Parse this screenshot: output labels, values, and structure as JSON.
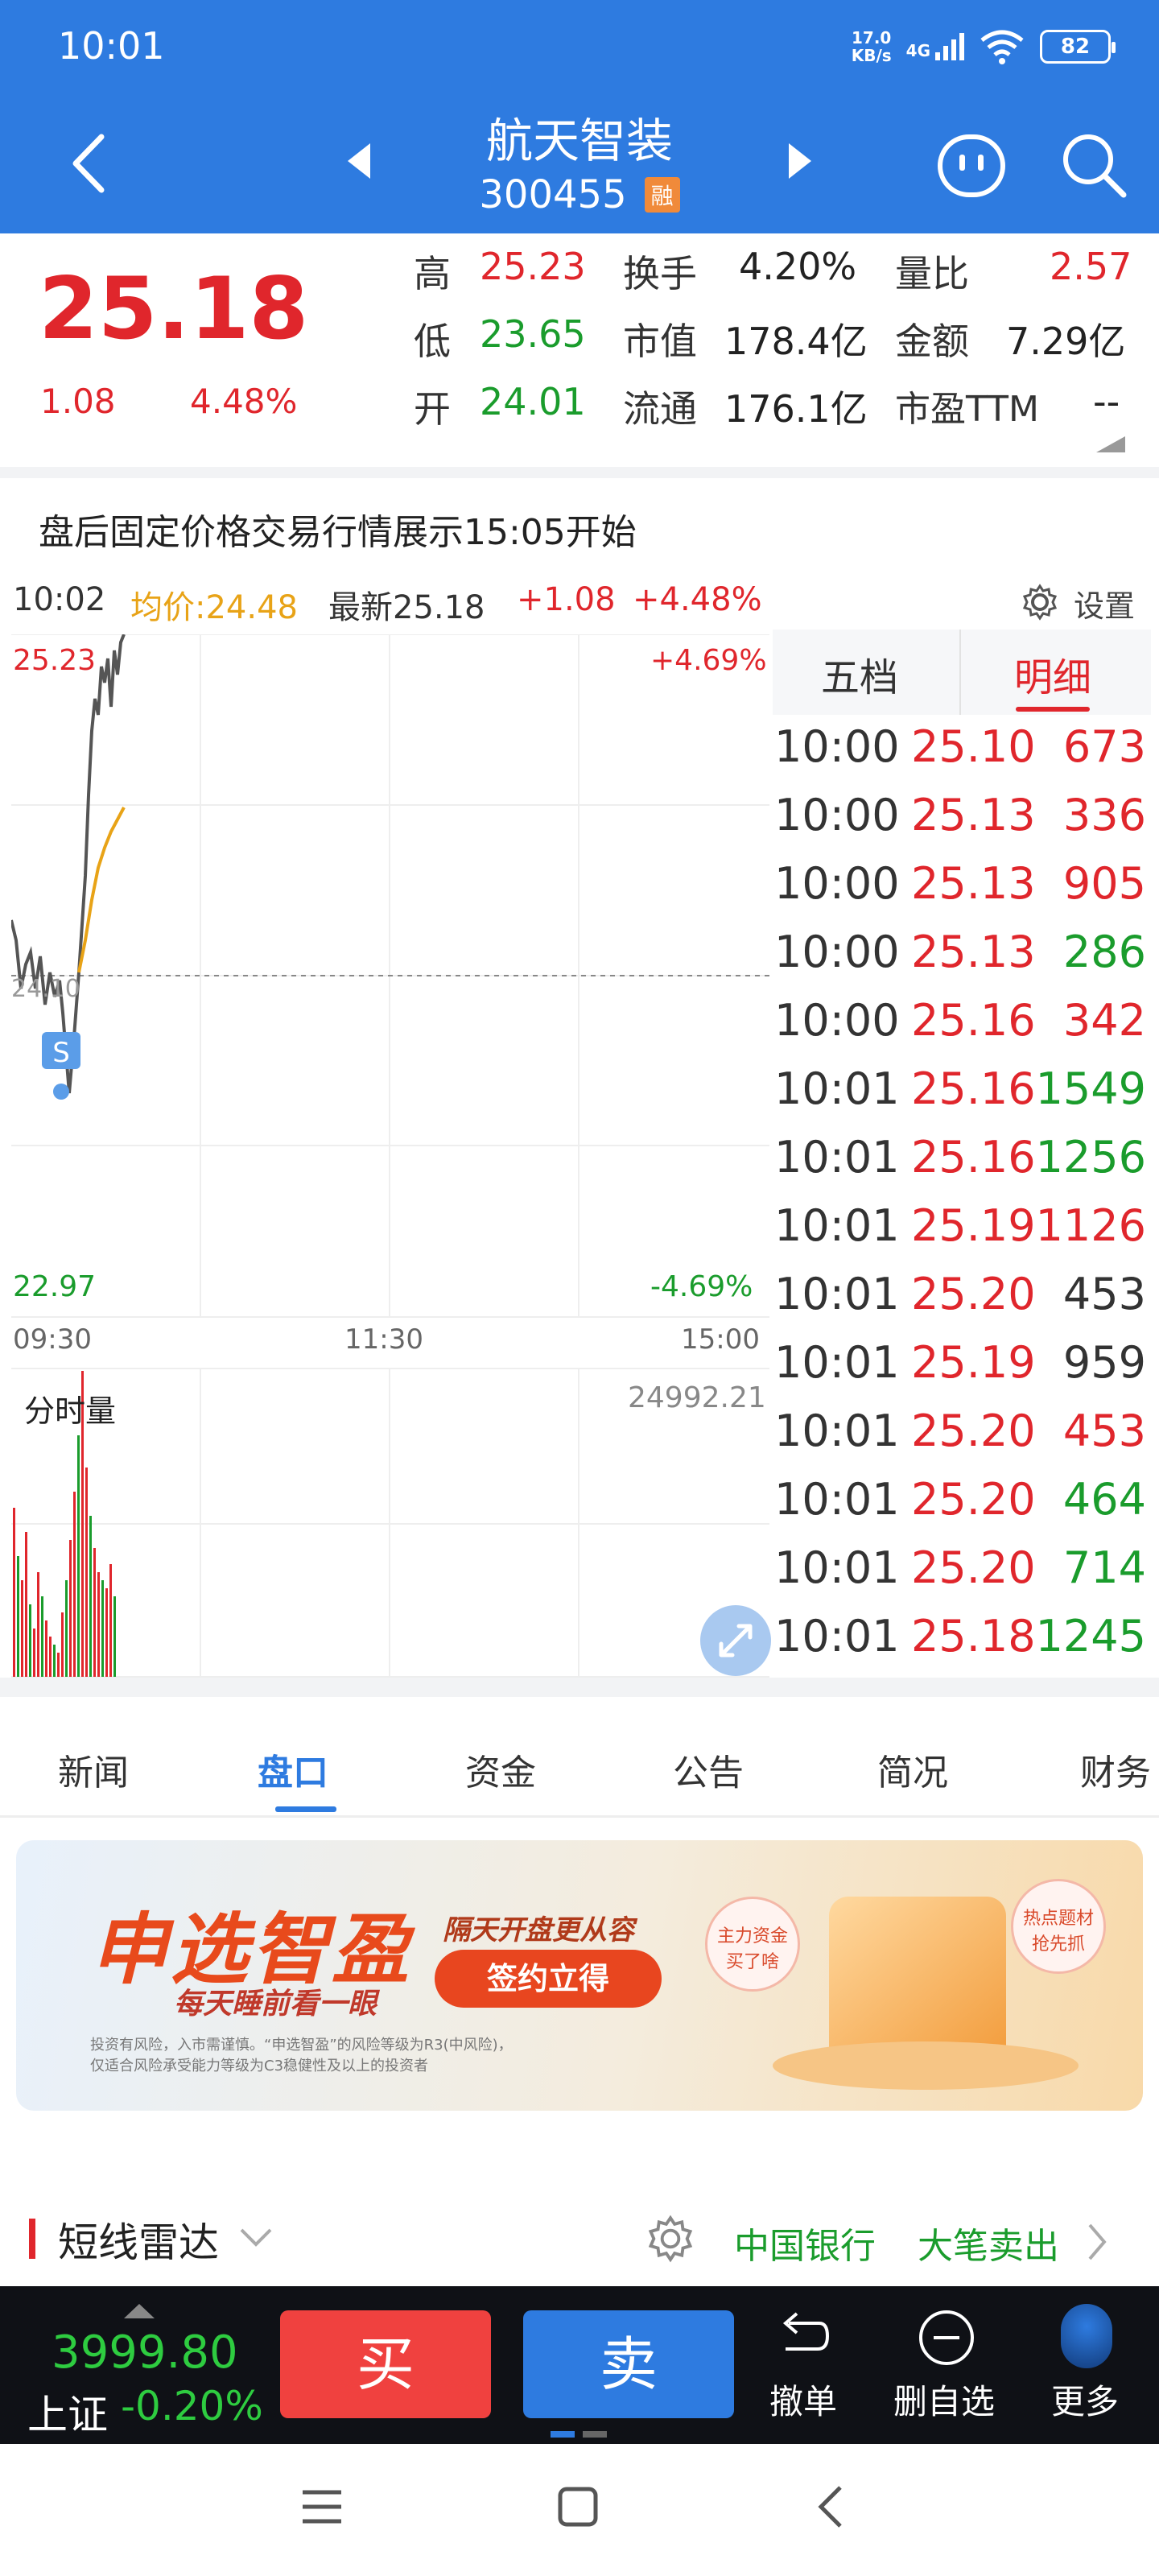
{
  "status_bar": {
    "time": "10:01",
    "net_speed": "17.0",
    "net_unit": "KB/s",
    "network": "4G",
    "battery": "82"
  },
  "header": {
    "title": "航天智装",
    "code": "300455",
    "badge": "融"
  },
  "quote": {
    "price": "25.18",
    "change": "1.08",
    "change_pct": "4.48%",
    "high_label": "高",
    "high": "25.23",
    "low_label": "低",
    "low": "23.65",
    "open_label": "开",
    "open": "24.01",
    "turnover_label": "换手",
    "turnover": "4.20%",
    "mcap_label": "市值",
    "mcap": "178.4亿",
    "float_label": "流通",
    "float_cap": "176.1亿",
    "vol_ratio_label": "量比",
    "vol_ratio": "2.57",
    "amount_label": "金额",
    "amount": "7.29亿",
    "pe_label": "市盈TTM",
    "pe": "--"
  },
  "notice": "盘后固定价格交易行情展示15:05开始",
  "chart_header": {
    "time": "10:02",
    "avg": "均价:24.48",
    "latest": "最新25.18",
    "chg": "+1.08",
    "chg_pct": "+4.48%",
    "settings": "设置"
  },
  "intraday": {
    "top_price": "25.23",
    "bottom_price": "22.97",
    "top_pct": "+4.69%",
    "bottom_pct": "-4.69%",
    "ref_price": "24.10",
    "marker": "S",
    "times": [
      "09:30",
      "11:30",
      "15:00"
    ],
    "volume_label": "分时量",
    "volume_max": "24992.21"
  },
  "detail_tabs": {
    "tab1": "五档",
    "tab2": "明细"
  },
  "ticks": [
    {
      "time": "10:00",
      "price": "25.10",
      "vol": "673",
      "pc": "red",
      "vc": "red"
    },
    {
      "time": "10:00",
      "price": "25.13",
      "vol": "336",
      "pc": "red",
      "vc": "red"
    },
    {
      "time": "10:00",
      "price": "25.13",
      "vol": "905",
      "pc": "red",
      "vc": "red"
    },
    {
      "time": "10:00",
      "price": "25.13",
      "vol": "286",
      "pc": "red",
      "vc": "green"
    },
    {
      "time": "10:00",
      "price": "25.16",
      "vol": "342",
      "pc": "red",
      "vc": "red"
    },
    {
      "time": "10:01",
      "price": "25.16",
      "vol": "1549",
      "pc": "red",
      "vc": "green"
    },
    {
      "time": "10:01",
      "price": "25.16",
      "vol": "1256",
      "pc": "red",
      "vc": "green"
    },
    {
      "time": "10:01",
      "price": "25.19",
      "vol": "1126",
      "pc": "red",
      "vc": "red"
    },
    {
      "time": "10:01",
      "price": "25.20",
      "vol": "453",
      "pc": "red",
      "vc": "gray"
    },
    {
      "time": "10:01",
      "price": "25.19",
      "vol": "959",
      "pc": "red",
      "vc": "gray"
    },
    {
      "time": "10:01",
      "price": "25.20",
      "vol": "453",
      "pc": "red",
      "vc": "red"
    },
    {
      "time": "10:01",
      "price": "25.20",
      "vol": "464",
      "pc": "red",
      "vc": "green"
    },
    {
      "time": "10:01",
      "price": "25.20",
      "vol": "714",
      "pc": "red",
      "vc": "green"
    },
    {
      "time": "10:01",
      "price": "25.18",
      "vol": "1245",
      "pc": "red",
      "vc": "green"
    }
  ],
  "bottom_tabs": [
    "新闻",
    "盘口",
    "资金",
    "公告",
    "简况",
    "财务"
  ],
  "banner": {
    "brand": "申选智盈",
    "slogan": "每天睡前看一眼",
    "headline": "隔天开盘更从容",
    "cta": "签约立得",
    "bubble1": "主力资金\n买了啥",
    "bubble2": "热点题材\n抢先抓",
    "disclaimer1": "投资有风险，入市需谨慎。“申选智盈”的风险等级为R3(中风险)，",
    "disclaimer2": "仅适合风险承受能力等级为C3稳健性及以上的投资者"
  },
  "radar": {
    "title": "短线雷达",
    "stock": "中国银行",
    "signal": "大笔卖出"
  },
  "trade_bar": {
    "index_value": "3999.80",
    "index_name": "上证",
    "index_pct": "-0.20%",
    "buy": "买",
    "sell": "卖",
    "cancel": "撤单",
    "remove_fav": "删自选",
    "more": "更多"
  },
  "colors": {
    "header_blue": "#2e7be0",
    "up_red": "#e0262c",
    "down_green": "#1a9c2c",
    "avg_orange": "#e8a317"
  }
}
